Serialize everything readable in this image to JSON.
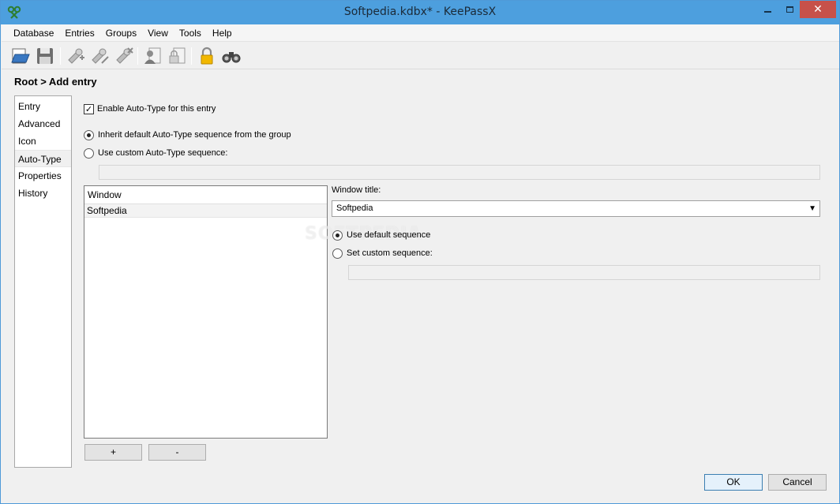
{
  "window": {
    "title": "Softpedia.kdbx* - KeePassX",
    "close_glyph": "✕"
  },
  "menu": [
    "Database",
    "Entries",
    "Groups",
    "View",
    "Tools",
    "Help"
  ],
  "toolbar_icons": [
    "open-database-icon",
    "save-database-icon",
    "add-entry-icon",
    "edit-entry-icon",
    "delete-entry-icon",
    "copy-username-icon",
    "copy-password-icon",
    "lock-database-icon",
    "search-icon"
  ],
  "breadcrumb": "Root > Add entry",
  "categories": [
    {
      "label": "Entry",
      "selected": false
    },
    {
      "label": "Advanced",
      "selected": false
    },
    {
      "label": "Icon",
      "selected": false
    },
    {
      "label": "Auto-Type",
      "selected": true
    },
    {
      "label": "Properties",
      "selected": false
    },
    {
      "label": "History",
      "selected": false
    }
  ],
  "autotype": {
    "enable_label": "Enable Auto-Type for this entry",
    "enable_checked": true,
    "inherit_label": "Inherit default Auto-Type sequence from the group",
    "inherit_selected": true,
    "custom_label": "Use custom Auto-Type sequence:",
    "custom_value": ""
  },
  "window_list": {
    "header": "Window",
    "rows": [
      "Softpedia"
    ]
  },
  "window_title": {
    "label": "Window title:",
    "value": "Softpedia"
  },
  "sequence": {
    "default_label": "Use default sequence",
    "default_selected": true,
    "custom_label": "Set custom sequence:",
    "custom_value": ""
  },
  "buttons": {
    "add": "+",
    "remove": "-",
    "ok": "OK",
    "cancel": "Cancel"
  },
  "watermark": "SOFTPEDIA"
}
